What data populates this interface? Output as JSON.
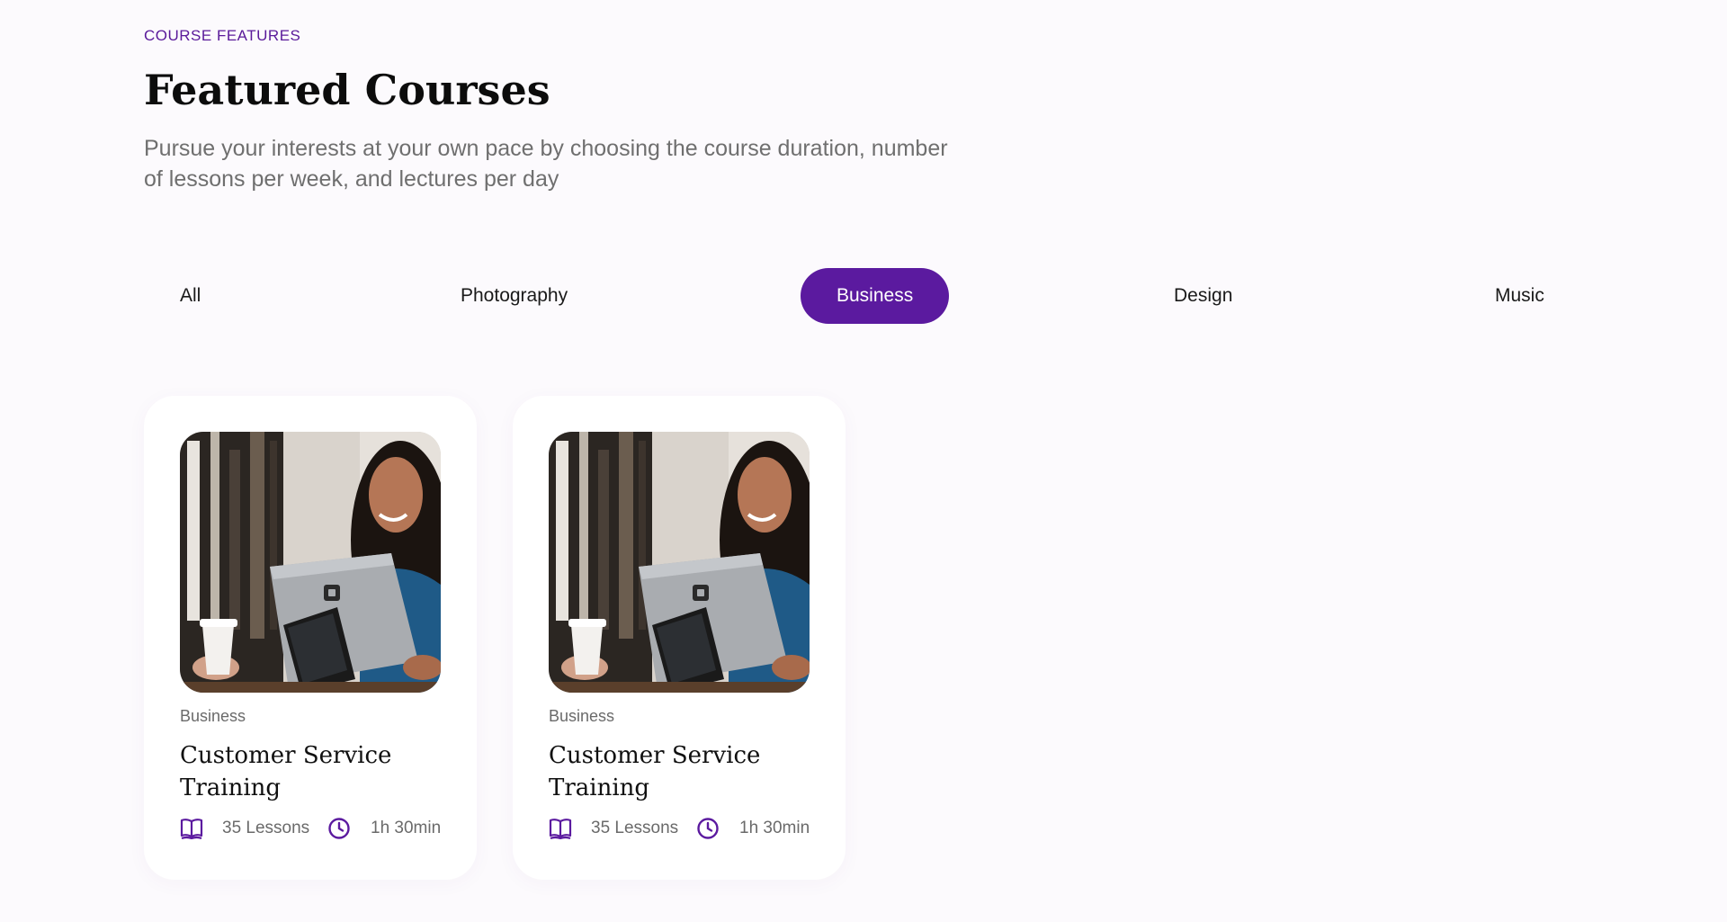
{
  "header": {
    "eyebrow": "COURSE FEATURES",
    "title": "Featured Courses",
    "subtitle": "Pursue your interests at your own pace by choosing the course duration, number of lessons per week, and lectures per day"
  },
  "tabs": [
    {
      "label": "All",
      "active": false
    },
    {
      "label": "Photography",
      "active": false
    },
    {
      "label": "Business",
      "active": true
    },
    {
      "label": "Design",
      "active": false
    },
    {
      "label": "Music",
      "active": false
    }
  ],
  "courses": [
    {
      "category": "Business",
      "title": "Customer Service Training",
      "lessons": "35 Lessons",
      "duration": "1h 30min",
      "image_icon": "woman-with-laptop-photo",
      "lessons_icon": "book-icon",
      "duration_icon": "clock-icon"
    },
    {
      "category": "Business",
      "title": "Customer Service Training",
      "lessons": "35 Lessons",
      "duration": "1h 30min",
      "image_icon": "woman-with-laptop-photo",
      "lessons_icon": "book-icon",
      "duration_icon": "clock-icon"
    }
  ],
  "colors": {
    "accent": "#5b1a9f",
    "background": "#fcfafd",
    "card": "#ffffff"
  }
}
